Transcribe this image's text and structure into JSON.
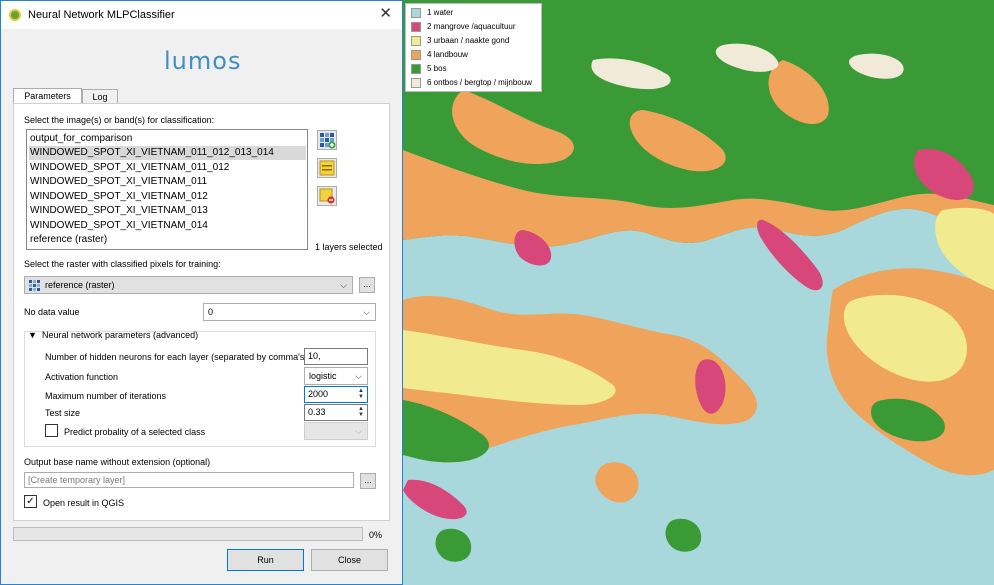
{
  "window": {
    "title": "Neural Network MLPClassifier",
    "logo": "lumos"
  },
  "tabs": [
    {
      "label": "Parameters"
    },
    {
      "label": "Log"
    }
  ],
  "images": {
    "label": "Select the image(s) or band(s) for classification:",
    "items": [
      "output_for_comparison",
      "WINDOWED_SPOT_XI_VIETNAM_011_012_013_014",
      "WINDOWED_SPOT_XI_VIETNAM_011_012",
      "WINDOWED_SPOT_XI_VIETNAM_011",
      "WINDOWED_SPOT_XI_VIETNAM_012",
      "WINDOWED_SPOT_XI_VIETNAM_013",
      "WINDOWED_SPOT_XI_VIETNAM_014",
      "reference (raster)"
    ],
    "selected_index": 1,
    "selected_count": "1 layers selected"
  },
  "training": {
    "label": "Select the raster with classified pixels for training:",
    "value": "reference (raster)",
    "browse": "..."
  },
  "nodata": {
    "label": "No data value",
    "value": "0"
  },
  "nn_params": {
    "header": "Neural network parameters (advanced)",
    "hidden_label": "Number of hidden neurons for each layer (separated by comma's)",
    "hidden_value": "10,",
    "activation_label": "Activation function",
    "activation_value": "logistic",
    "iter_label": "Maximum number of iterations",
    "iter_value": "2000",
    "test_label": "Test size",
    "test_value": "0.33",
    "predict_label": "Predict probality of a selected class"
  },
  "output": {
    "label": "Output base name without extension (optional)",
    "placeholder": "[Create temporary layer]",
    "browse": "..."
  },
  "open_result": {
    "label": "Open result in QGIS",
    "checked": true
  },
  "progress": {
    "value": 0,
    "label": "0%"
  },
  "buttons": {
    "run": "Run",
    "close": "Close"
  },
  "legend": [
    {
      "label": "1 water",
      "color": "#a8d8dc"
    },
    {
      "label": "2 mangrove /aquacultuur",
      "color": "#d7477a"
    },
    {
      "label": "3 urbaan / naakte gond",
      "color": "#f2ea8e"
    },
    {
      "label": "4 landbouw",
      "color": "#f0a35a"
    },
    {
      "label": "5 bos",
      "color": "#3a9a35"
    },
    {
      "label": "6 ontbos / bergtop / mijnbouw",
      "color": "#f1ead9"
    }
  ]
}
